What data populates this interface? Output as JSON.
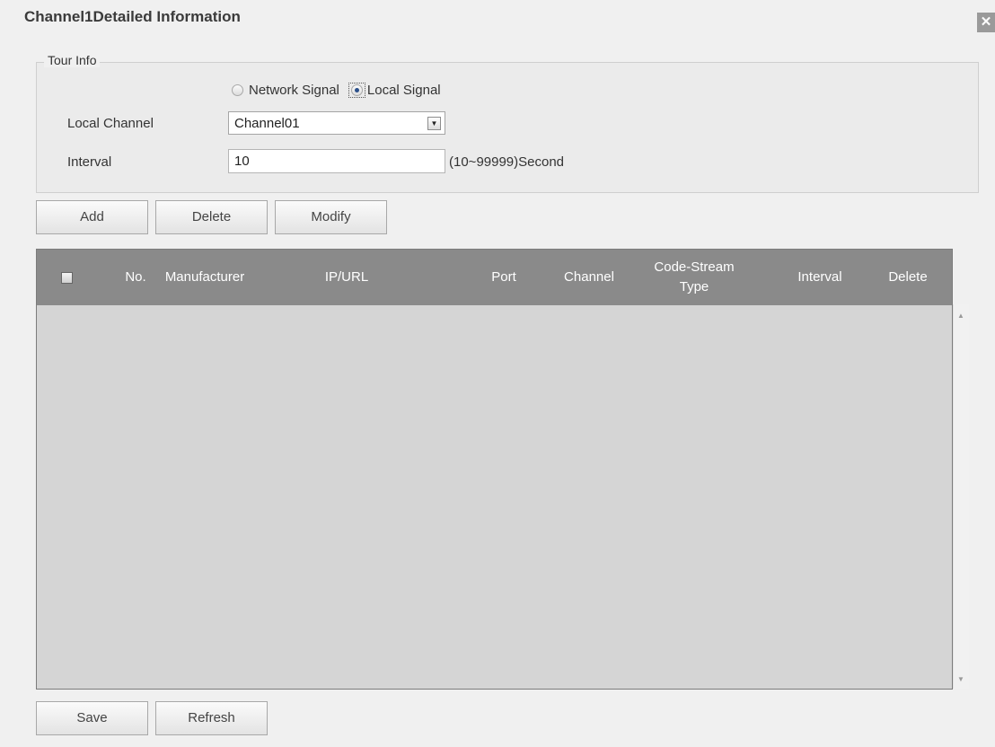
{
  "window": {
    "title": "Channel1Detailed Information",
    "close_icon": "close-icon"
  },
  "tour_info": {
    "legend": "Tour Info",
    "signal_options": [
      {
        "label": "Network Signal",
        "selected": false
      },
      {
        "label": "Local Signal",
        "selected": true
      }
    ],
    "local_channel_label": "Local Channel",
    "local_channel_value": "Channel01",
    "interval_label": "Interval",
    "interval_value": "10",
    "interval_hint": "(10~99999)Second"
  },
  "actions": {
    "add": "Add",
    "delete": "Delete",
    "modify": "Modify"
  },
  "table": {
    "columns": {
      "no": "No.",
      "manufacturer": "Manufacturer",
      "ip_url": "IP/URL",
      "port": "Port",
      "channel": "Channel",
      "code_stream_type": "Code-Stream Type",
      "interval": "Interval",
      "delete": "Delete"
    },
    "rows": []
  },
  "footer": {
    "save": "Save",
    "refresh": "Refresh"
  },
  "colors": {
    "header_bg": "#8a8a8a",
    "table_bg": "#d5d5d5",
    "page_bg": "#f0f0f0"
  }
}
